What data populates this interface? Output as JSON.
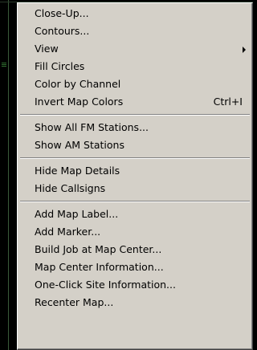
{
  "context_menu": {
    "groups": [
      {
        "items": [
          {
            "label": "Close-Up..."
          },
          {
            "label": "Contours..."
          },
          {
            "label": "View",
            "submenu": true
          },
          {
            "label": "Fill Circles"
          },
          {
            "label": "Color by Channel"
          },
          {
            "label": "Invert Map Colors",
            "shortcut": "Ctrl+I"
          }
        ]
      },
      {
        "items": [
          {
            "label": "Show All FM Stations..."
          },
          {
            "label": "Show AM Stations"
          }
        ]
      },
      {
        "items": [
          {
            "label": "Hide Map Details"
          },
          {
            "label": "Hide Callsigns"
          }
        ]
      },
      {
        "items": [
          {
            "label": "Add Map Label..."
          },
          {
            "label": "Add Marker..."
          },
          {
            "label": "Build Job at Map Center..."
          },
          {
            "label": "Map Center Information..."
          },
          {
            "label": "One-Click Site Information..."
          },
          {
            "label": "Recenter Map..."
          }
        ]
      }
    ]
  },
  "colors": {
    "menu_face": "#d4d0c8",
    "map_background": "#000000",
    "map_line": "#2f6f2f"
  },
  "icons": {
    "submenu": "submenu-arrow-icon"
  }
}
